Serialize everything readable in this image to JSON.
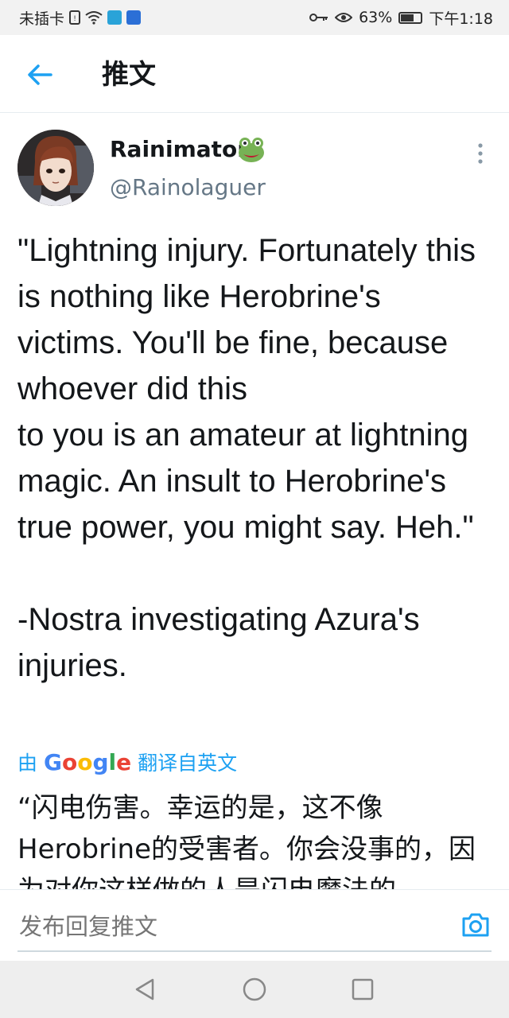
{
  "status_bar": {
    "carrier": "未插卡",
    "battery": "63%",
    "time": "下午1:18"
  },
  "header": {
    "title": "推文"
  },
  "tweet": {
    "author_name": "Rainimator",
    "author_emoji": "🐸",
    "author_handle": "@Rainolaguer",
    "text": "\"Lightning injury. Fortunately this is nothing like Herobrine's victims. You'll be fine, because whoever did this\nto you is an amateur at lightning magic. An insult to Herobrine's true power, you might say. Heh.\"\n\n-Nostra investigating Azura's injuries.",
    "translation_by": "由",
    "translation_brand": "Google",
    "translation_suffix": "翻译自英文",
    "translated_text": "“闪电伤害。幸运的是，这不像Herobrine的受害者。你会没事的，因为对你这样做的人是闪电魔法的"
  },
  "reply": {
    "placeholder": "发布回复推文"
  },
  "colors": {
    "accent": "#1da1f2",
    "secondary_text": "#657786"
  }
}
